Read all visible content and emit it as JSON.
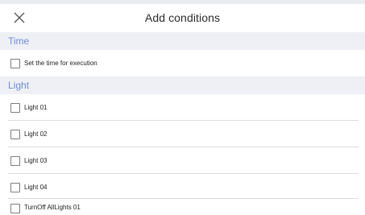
{
  "header": {
    "title": "Add conditions"
  },
  "sections": [
    {
      "title": "Time"
    },
    {
      "title": "Light"
    }
  ],
  "time_items": [
    {
      "label": "Set the time for execution",
      "checked": false
    }
  ],
  "light_items": [
    {
      "label": "Light 01",
      "checked": false
    },
    {
      "label": "Light 02",
      "checked": false
    },
    {
      "label": "Light 03",
      "checked": false
    },
    {
      "label": "Light 04",
      "checked": false
    },
    {
      "label": "TurnOff AllLights 01",
      "checked": false
    }
  ],
  "colors": {
    "section_bg": "#eef0f5",
    "section_text": "#6f8bd6",
    "divider": "#dcdcdc"
  },
  "icons": {
    "close": "close-icon",
    "checkbox": "checkbox-icon"
  }
}
